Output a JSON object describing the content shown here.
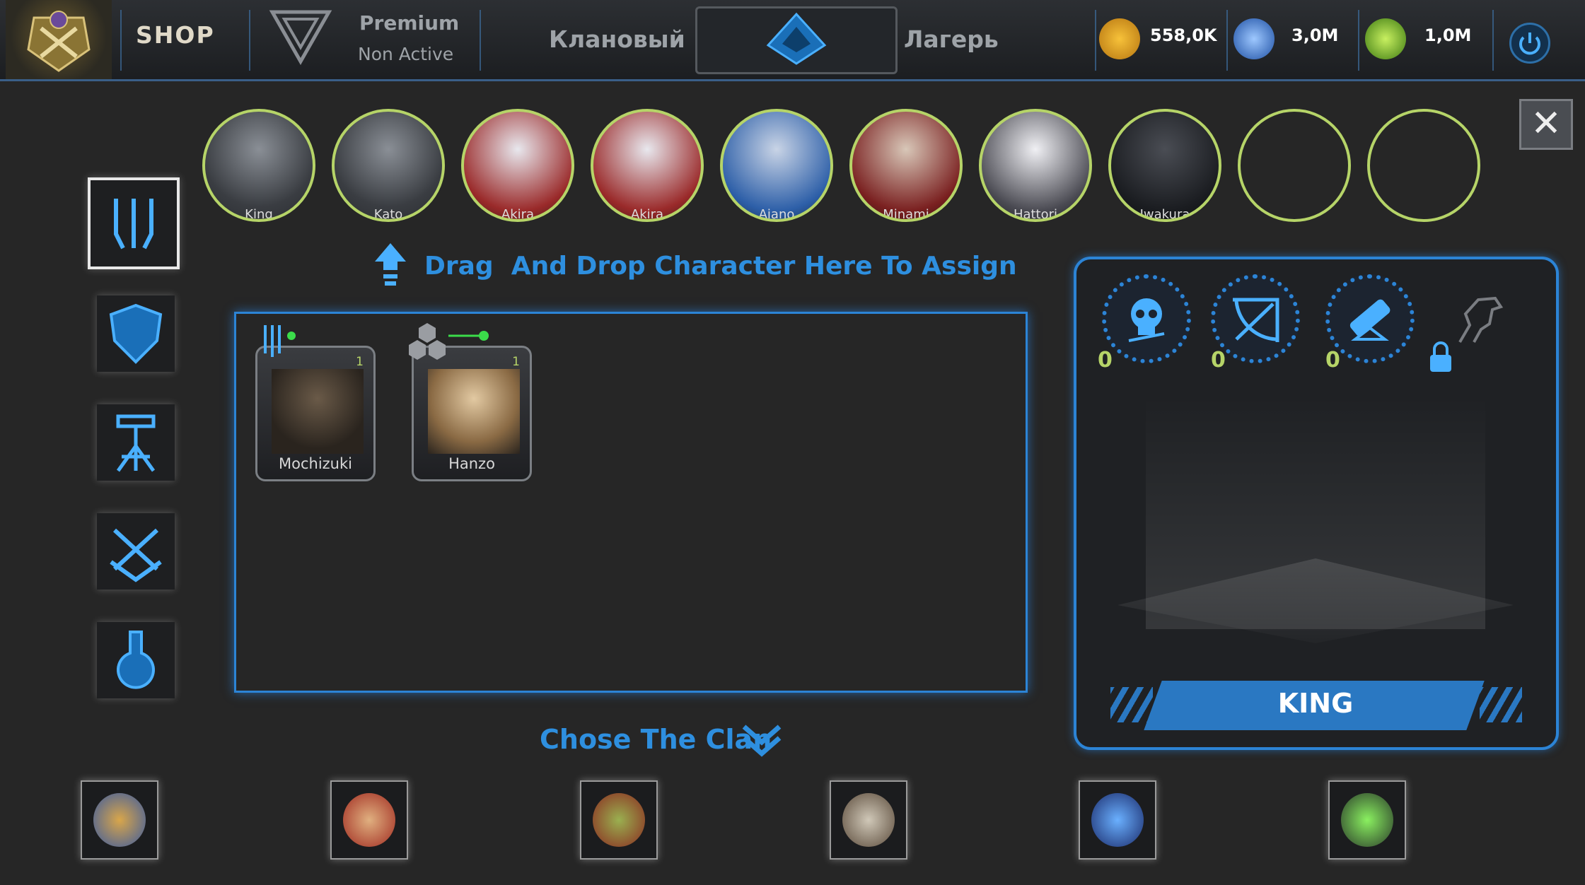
{
  "header": {
    "shop_label": "SHOP",
    "premium_label": "Premium",
    "premium_status": "Non Active",
    "tab_clan": "Клановый",
    "tab_camp": "Лагерь",
    "resources": [
      {
        "icon": "gold-skull-coin-icon",
        "value": "558,0K"
      },
      {
        "icon": "blue-crystal-icon",
        "value": "3,0M"
      },
      {
        "icon": "green-gear-icon",
        "value": "1,0M"
      }
    ]
  },
  "heroes": [
    {
      "name": "King"
    },
    {
      "name": "Kato"
    },
    {
      "name": "Akira"
    },
    {
      "name": "Akira"
    },
    {
      "name": "Aiano"
    },
    {
      "name": "Minami"
    },
    {
      "name": "Hattori"
    },
    {
      "name": "Iwakura"
    },
    {
      "name": ""
    },
    {
      "name": ""
    }
  ],
  "side_menu": [
    {
      "id": "spears",
      "icon": "trident-icon",
      "active": true
    },
    {
      "id": "defense",
      "icon": "shield-icon",
      "active": false
    },
    {
      "id": "ranged",
      "icon": "ballista-icon",
      "active": false
    },
    {
      "id": "combat",
      "icon": "crossed-swords-icon",
      "active": false
    },
    {
      "id": "alchemy",
      "icon": "potion-flask-icon",
      "active": false
    }
  ],
  "drag_hint": "Drag  And Drop Character Here To Assign",
  "assigned": [
    {
      "name": "Mochizuki",
      "level": "1",
      "class_icon": "trident-icon"
    },
    {
      "name": "Hanzo",
      "level": "1",
      "class_icon": "hex-cluster-icon"
    }
  ],
  "choose_clan": "Chose The Clan",
  "clans": [
    {
      "icon": "dwarf-clan-icon"
    },
    {
      "icon": "spartan-clan-icon"
    },
    {
      "icon": "goblin-clan-icon"
    },
    {
      "icon": "viking-clan-icon"
    },
    {
      "icon": "hooded-clan-icon"
    },
    {
      "icon": "zombie-clan-icon"
    }
  ],
  "panel": {
    "stats": [
      {
        "icon": "skull-icon",
        "value": "0"
      },
      {
        "icon": "crossbow-icon",
        "value": "0"
      },
      {
        "icon": "cannon-icon",
        "value": "0"
      }
    ],
    "locked_icon": "horse-icon",
    "selected_name": "KING"
  },
  "colors": {
    "accent": "#2c84d6",
    "hero_ring": "#b6d468",
    "level": "#b6d468"
  }
}
